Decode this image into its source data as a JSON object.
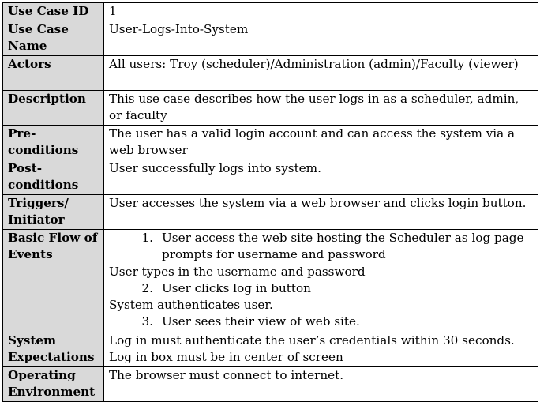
{
  "rows": [
    {
      "key": "Use Case ID",
      "value": "1"
    },
    {
      "key": "Use Case Name",
      "value": "User-Logs-Into-System"
    },
    {
      "key": "Actors",
      "value": "All users: Troy (scheduler)/Administration (admin)/Faculty (viewer)"
    },
    {
      "key": "Description",
      "value": "This use case describes how the user logs in as a scheduler, admin, or faculty"
    },
    {
      "key": "Pre-conditions",
      "value": "The user has a valid login account and can access the system via a web browser"
    },
    {
      "key": "Post-conditions",
      "value": "User successfully logs into system."
    },
    {
      "key": "Triggers/ Initiator",
      "value": "User accesses the system via a web browser and clicks login button."
    },
    {
      "key": "Basic Flow of Events",
      "flow": [
        {
          "num": "1.",
          "text": "User access the web site hosting the Scheduler as log page prompts for username and password"
        },
        {
          "plain": "User types in the username and password"
        },
        {
          "num": "2.",
          "text": "User clicks log in button"
        },
        {
          "plain": "System authenticates user."
        },
        {
          "num": "3.",
          "text": "User sees their view of web site."
        }
      ]
    },
    {
      "key": "System Expectations",
      "lines": [
        "Log in must authenticate the user’s credentials within 30 seconds.",
        "Log in box must be in center of screen"
      ]
    },
    {
      "key": "Operating Environment",
      "value": "The browser must connect to internet."
    }
  ]
}
